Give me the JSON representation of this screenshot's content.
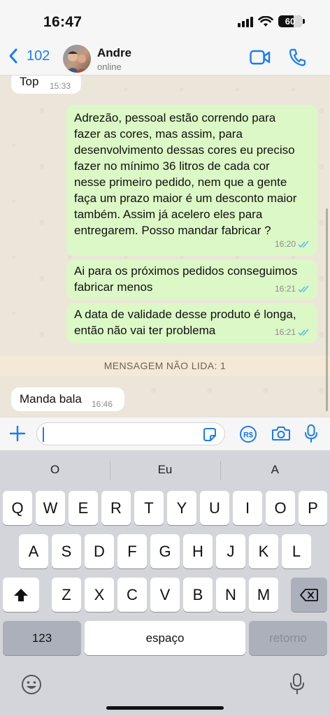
{
  "status_bar": {
    "time": "16:47",
    "battery": "60"
  },
  "header": {
    "back_count": "102",
    "contact_name": "Andre",
    "contact_status": "online"
  },
  "messages": [
    {
      "direction": "in",
      "text": "Top",
      "time": "15:33"
    },
    {
      "direction": "out",
      "lines": [
        "Adrezão, pessoal estão correndo para",
        "fazer as cores, mas assim, para",
        "desenvolvimento dessas cores eu preciso",
        "fazer no mínimo 36 litros de cada cor",
        "nesse primeiro pedido, nem  que a gente",
        "faça um prazo maior é um desconto maior",
        "também. Assim já acelero eles para",
        "entregarem. Posso mandar fabricar ?"
      ],
      "time": "16:20"
    },
    {
      "direction": "out",
      "lines": [
        "Ai para os próximos pedidos conseguimos",
        "fabricar menos"
      ],
      "time": "16:21"
    },
    {
      "direction": "out",
      "lines": [
        "A data de validade desse produto é longa,",
        "então não vai ter problema"
      ],
      "time": "16:21"
    },
    {
      "direction": "in",
      "text": "Manda bala",
      "time": "16:46"
    }
  ],
  "unread_banner": "MENSAGEM NÃO LIDA: 1",
  "input": {
    "value": ""
  },
  "keyboard": {
    "suggestions": [
      "O",
      "Eu",
      "A"
    ],
    "row1": [
      "Q",
      "W",
      "E",
      "R",
      "T",
      "Y",
      "U",
      "I",
      "O",
      "P"
    ],
    "row2": [
      "A",
      "S",
      "D",
      "F",
      "G",
      "H",
      "J",
      "K",
      "L"
    ],
    "row3": [
      "Z",
      "X",
      "C",
      "V",
      "B",
      "N",
      "M"
    ],
    "numbers_key": "123",
    "space_key": "espaço",
    "return_key": "retorno"
  },
  "colors": {
    "accent": "#1a7cf0",
    "outgoing_bubble": "#dcf8c6",
    "incoming_bubble": "#ffffff",
    "read_ticks": "#53bdeb"
  }
}
